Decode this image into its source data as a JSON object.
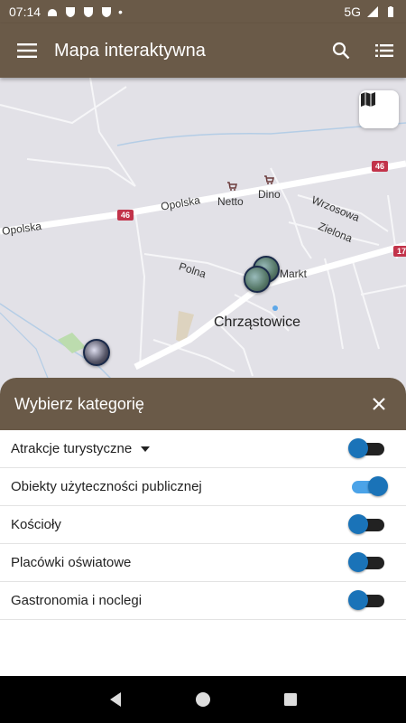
{
  "status_bar": {
    "time": "07:14",
    "network": "5G",
    "dot": "•"
  },
  "app_bar": {
    "title": "Mapa interaktywna"
  },
  "map": {
    "labels": {
      "opolska_left": "Opolska",
      "opolska_mid": "Opolska",
      "netto": "Netto",
      "dino": "Dino",
      "wrzosowa": "Wrzosowa",
      "zielona": "Zielona",
      "polna": "Polna",
      "markt": "Markt",
      "chrzastowice": "Chrząstowice"
    },
    "road_46_a": "46",
    "road_46_b": "46",
    "road_17": "17"
  },
  "sheet": {
    "title": "Wybierz kategorię",
    "categories": [
      {
        "label": "Atrakcje turystyczne",
        "on": false,
        "has_caret": true
      },
      {
        "label": "Obiekty użyteczności publicznej",
        "on": true,
        "has_caret": false
      },
      {
        "label": "Kościoły",
        "on": false,
        "has_caret": false
      },
      {
        "label": "Placówki oświatowe",
        "on": false,
        "has_caret": false
      },
      {
        "label": "Gastronomia i noclegi",
        "on": false,
        "has_caret": false
      }
    ]
  },
  "colors": {
    "primary": "#6a5a48",
    "toggle_knob": "#1a73b8",
    "toggle_track_on": "#4ba3e8"
  }
}
